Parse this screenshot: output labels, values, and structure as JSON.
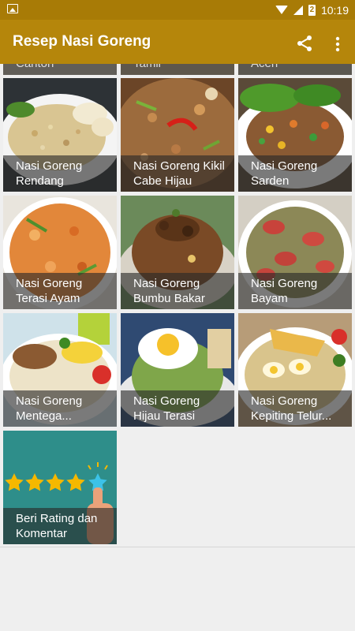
{
  "status_bar": {
    "time": "10:19",
    "battery": "2"
  },
  "app_bar": {
    "title": "Resep Nasi Goreng"
  },
  "partial_row": [
    "Canton",
    "Tamil",
    "Aceh"
  ],
  "tiles": [
    {
      "label": "Nasi Goreng Rendang"
    },
    {
      "label": "Nasi Goreng Kikil Cabe Hijau"
    },
    {
      "label": "Nasi Goreng Sarden"
    },
    {
      "label": "Nasi Goreng Terasi Ayam"
    },
    {
      "label": "Nasi Goreng Bumbu Bakar"
    },
    {
      "label": "Nasi Goreng Bayam"
    },
    {
      "label": "Nasi Goreng Mentega..."
    },
    {
      "label": "Nasi Goreng Hijau Terasi"
    },
    {
      "label": "Nasi Goreng Kepiting Telur..."
    },
    {
      "label": "Beri Rating dan Komentar"
    }
  ],
  "colors": {
    "status_bar": "#a87b06",
    "app_bar": "#b5860b",
    "background": "#efefef"
  }
}
